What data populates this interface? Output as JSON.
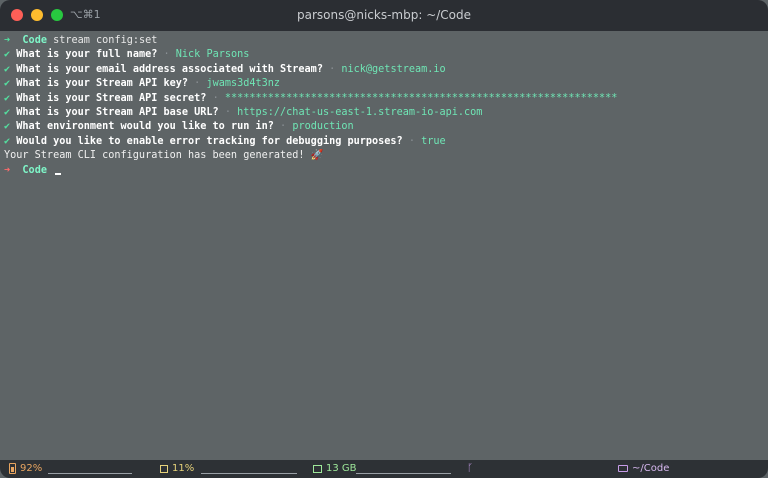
{
  "window": {
    "shortcut": "⌥⌘1",
    "title": "parsons@nicks-mbp: ~/Code"
  },
  "terminal": {
    "prompt_symbol": "➜",
    "directory": "Code",
    "command": "stream config:set",
    "check_symbol": "✔",
    "separator": "·",
    "qa": [
      {
        "question": "What is your full name?",
        "answer": "Nick Parsons"
      },
      {
        "question": "What is your email address associated with Stream?",
        "answer": "nick@getstream.io"
      },
      {
        "question": "What is your Stream API key?",
        "answer": "jwams3d4t3nz"
      },
      {
        "question": "What is your Stream API secret?",
        "answer": "****************************************************************"
      },
      {
        "question": "What is your Stream API base URL?",
        "answer": "https://chat-us-east-1.stream-io-api.com"
      },
      {
        "question": "What environment would you like to run in?",
        "answer": "production"
      },
      {
        "question": "Would you like to enable error tracking for debugging purposes?",
        "answer": "true"
      }
    ],
    "result_message": "Your Stream CLI configuration has been generated! 🚀",
    "final_prompt_symbol": "➜",
    "final_directory": "Code"
  },
  "statusbar": {
    "battery": "92%",
    "cpu": "11%",
    "memory": "13 GB",
    "path": "~/Code",
    "icons": {
      "battery": "battery-icon",
      "cpu": "cpu-icon",
      "memory": "memory-icon",
      "git": "git-branch-icon",
      "folder": "folder-icon"
    }
  }
}
